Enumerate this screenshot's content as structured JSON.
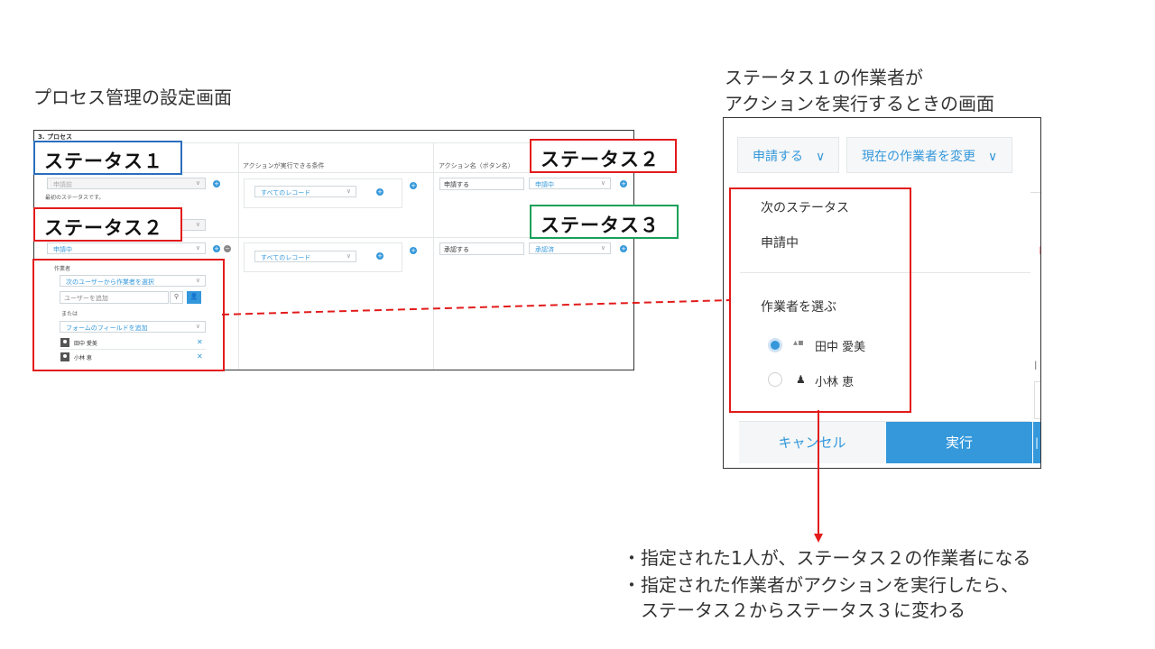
{
  "left_title": "プロセス管理の設定画面",
  "right_title_line1": "ステータス１の作業者が",
  "right_title_line2": "アクションを実行するときの画面",
  "process_screen": {
    "section_title": "3. プロセス",
    "header_condition": "アクションが実行できる条件",
    "header_action_name": "アクション名（ボタン名）",
    "row1": {
      "status_value": "申請前",
      "first_status_note": "最初のステータスです。",
      "condition_value": "すべてのレコード",
      "action_name": "申請する",
      "next_status": "申請中"
    },
    "row2": {
      "status_value": "申請中",
      "condition_value": "すべてのレコード",
      "action_name": "承認する",
      "next_status": "承認済"
    },
    "assignee": {
      "label": "作業者",
      "mode_value": "次のユーザーから作業者を選択",
      "user_placeholder": "ユーザーを追加",
      "or_label": "または",
      "field_value": "フォームのフィールドを追加",
      "users": [
        "田中 愛美",
        "小林 恵"
      ]
    }
  },
  "labels": {
    "status1": "ステータス１",
    "status2_top": "ステータス２",
    "status2_left": "ステータス２",
    "status3": "ステータス３"
  },
  "action_panel": {
    "action_button": "申請する",
    "change_assignee_button": "現在の作業者を変更",
    "next_status_label": "次のステータス",
    "next_status_value": "申請中",
    "choose_assignee_label": "作業者を選ぶ",
    "assignees": [
      "田中 愛美",
      "小林 恵"
    ],
    "cancel": "キャンセル",
    "execute": "実行"
  },
  "notes": {
    "line1": "・指定された1人が、ステータス２の作業者になる",
    "line2": "・指定された作業者がアクションを実行したら、",
    "line3": "ステータス２からステータス３に変わる"
  },
  "colors": {
    "accent": "#3498db",
    "red": "#e31b1b",
    "blue": "#2a6ebd",
    "green": "#1aa05a"
  }
}
